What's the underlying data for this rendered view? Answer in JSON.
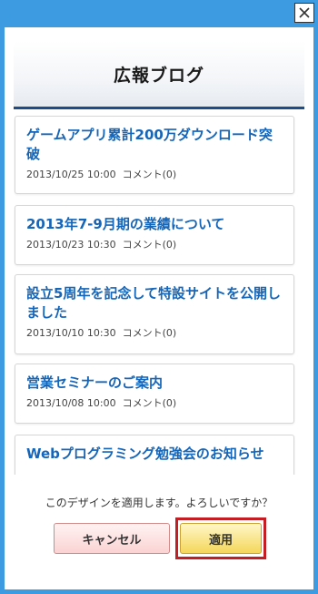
{
  "header": {
    "title": "広報ブログ"
  },
  "posts": [
    {
      "title": "ゲームアプリ累計200万ダウンロード突破",
      "date": "2013/10/25 10:00",
      "comments": "コメント(0)"
    },
    {
      "title": "2013年7-9月期の業績について",
      "date": "2013/10/23 10:30",
      "comments": "コメント(0)"
    },
    {
      "title": "設立5周年を記念して特設サイトを公開しました",
      "date": "2013/10/10 10:30",
      "comments": "コメント(0)"
    },
    {
      "title": "営業セミナーのご案内",
      "date": "2013/10/08 10:00",
      "comments": "コメント(0)"
    },
    {
      "title": "Webプログラミング勉強会のお知らせ",
      "date": "",
      "comments": ""
    }
  ],
  "confirm": {
    "message": "このデザインを適用します。よろしいですか？",
    "cancel_label": "キャンセル",
    "apply_label": "適用"
  },
  "icons": {
    "close": "close-icon"
  },
  "colors": {
    "frame": "#3d9be2",
    "title_link": "#1565b8",
    "header_rule": "#1d4c86",
    "highlight": "#c41e24"
  }
}
